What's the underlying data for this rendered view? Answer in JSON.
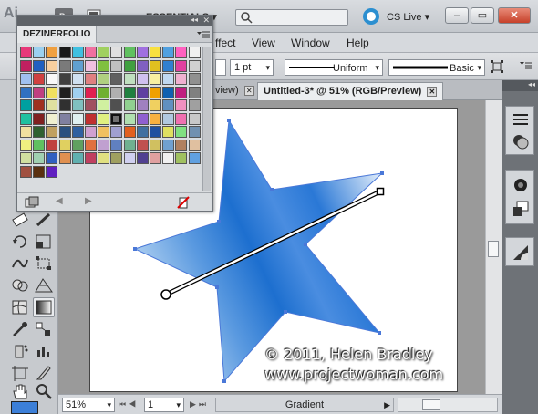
{
  "app": {
    "logo_text": "Ai",
    "bridge_label": "Br",
    "workspace": "ESSENTIALS",
    "search_placeholder": "",
    "cs_live": "CS Live"
  },
  "menu": [
    "ffect",
    "View",
    "Window",
    "Help"
  ],
  "control": {
    "stroke_weight": "1 pt",
    "profile": "Uniform",
    "brush": "Basic"
  },
  "doc_tabs": [
    {
      "label": "view)",
      "active": false
    },
    {
      "label": "Untitled-3* @ 51% (RGB/Preview)",
      "active": true
    }
  ],
  "swatch_panel": {
    "tab_name": "DEZINERFOLIO",
    "colors": [
      "#e8397a",
      "#9ad0f0",
      "#f0a040",
      "#1a1a1a",
      "#40c0e0",
      "#f070a0",
      "#a0d060",
      "#e0e0e0",
      "#60c060",
      "#a070e0",
      "#f8e040",
      "#50a0e0",
      "#ff60c0",
      "#f0f0f0",
      "#c02060",
      "#2060c0",
      "#f8d0a0",
      "#7a7a7a",
      "#60a0d0",
      "#f0c0e0",
      "#80c040",
      "#c0c0c0",
      "#40a040",
      "#8060c0",
      "#e0c020",
      "#3080d0",
      "#e040a0",
      "#d0d0d0",
      "#a0c0f0",
      "#d04040",
      "#f8f8f8",
      "#404040",
      "#d0e0f0",
      "#e08080",
      "#b0d080",
      "#606060",
      "#c0e0c0",
      "#d0c0f0",
      "#f8f0a0",
      "#c0d8f0",
      "#f0b0d0",
      "#909090",
      "#3070c0",
      "#c04080",
      "#f0e060",
      "#202020",
      "#a0d0f0",
      "#e02050",
      "#70b030",
      "#b0b0b0",
      "#208040",
      "#6040a0",
      "#f0a000",
      "#1060b0",
      "#c02080",
      "#808080",
      "#00a0a0",
      "#a03020",
      "#e0e0a0",
      "#303030",
      "#80c0c0",
      "#a05060",
      "#d0f0a0",
      "#505050",
      "#90d090",
      "#a080c0",
      "#f0d060",
      "#6090c0",
      "#f090c0",
      "#a0a0a0",
      "#20c0a0",
      "#802020",
      "#f0f0d0",
      "#8080a0",
      "#e0f0f0",
      "#c03030",
      "#e0f080",
      "#707070",
      "#b0e0b0",
      "#9060d0",
      "#f8b040",
      "#b0c8e0",
      "#f070b0",
      "#c8c8c8",
      "#f0e0a0",
      "#306030",
      "#c0a060",
      "#2a5080",
      "#3060a0",
      "#d0a0d0",
      "#f0c060",
      "#a0a0d0",
      "#e06020",
      "#4070a0",
      "#2050a0",
      "#e0e060",
      "#80e080",
      "#7090b0",
      "#f0f080",
      "#60c060",
      "#c04040",
      "#e0d060",
      "#60a060",
      "#e07040",
      "#c0a0d0",
      "#6080c0",
      "#70b090",
      "#c05050",
      "#d0c060",
      "#70a0d0",
      "#b08060",
      "#e0c0a0",
      "#d0e0a0",
      "#a0d0b0",
      "#3060c0",
      "#e09050",
      "#60b0b0",
      "#c04060",
      "#e0e080",
      "#a0a060",
      "#d0d0f0",
      "#504090",
      "#e0a0a0",
      "#f0f0f0",
      "#a0c060",
      "#60a0e0",
      "#a05040",
      "#5a3010",
      "#6020c0"
    ]
  },
  "status": {
    "zoom": "51%",
    "page": "1",
    "tool": "Gradient"
  },
  "watermark": {
    "line1": "© 2011, Helen Bradley",
    "line2": "www.projectwoman.com"
  },
  "colors": {
    "accent": "#2c8fd0",
    "star_dark": "#1d6fcf",
    "star_light": "#bcd8f3",
    "selection": "#4a78d8"
  }
}
